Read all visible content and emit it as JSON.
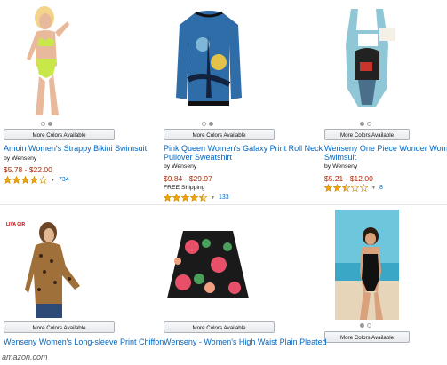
{
  "more_colors_label": "More Colors Available",
  "products": [
    {
      "title": "Amoin Women's Strappy Bikini Swimsuit",
      "by": "by Wenseny",
      "price": "$5.78 - $22.00",
      "rating": 4,
      "reviews": "734"
    },
    {
      "title": "Pink Queen Women's Galaxy Print Roll Neck",
      "title2": "Pullover Sweatshirt",
      "by": "by Wenseny",
      "price": "$9.84 - $29.97",
      "shipping": "FREE Shipping",
      "rating": 4.5,
      "reviews": "133"
    },
    {
      "title": "Wenseny One Piece Wonder Woman C",
      "title2": "Swimsuit",
      "by": "by Wenseny",
      "price": "$5.21 - $12.00",
      "rating": 2.5,
      "reviews": "8"
    },
    {
      "title": "Wenseny Women's Long-sleeve Print Chiffon",
      "brand_tag": "LIVA GIRL"
    },
    {
      "title": "Wenseny - Women's High Waist Plain Pleated"
    },
    {}
  ],
  "watermark": "amazon.com",
  "colors": {
    "link": "#0066c0",
    "price": "#b12704",
    "star": "#f0a30a"
  }
}
